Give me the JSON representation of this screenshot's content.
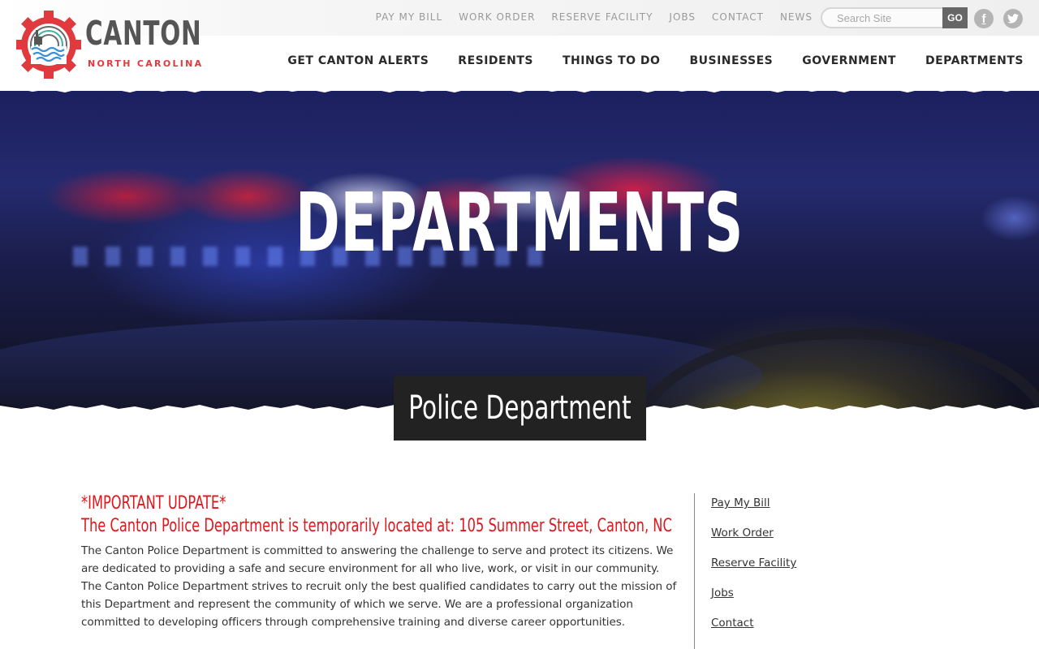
{
  "brand": {
    "name": "CANTON",
    "subtitle": "NORTH CAROLINA",
    "accent_color": "#e03a3e"
  },
  "utility_nav": [
    {
      "label": "PAY MY BILL"
    },
    {
      "label": "WORK ORDER"
    },
    {
      "label": "RESERVE FACILITY"
    },
    {
      "label": "JOBS"
    },
    {
      "label": "CONTACT"
    },
    {
      "label": "NEWS"
    }
  ],
  "search": {
    "placeholder": "Search Site",
    "value": "",
    "button_label": "GO"
  },
  "social": [
    {
      "icon": "facebook-icon",
      "glyph": "f"
    },
    {
      "icon": "twitter-icon",
      "glyph": "🐦"
    }
  ],
  "main_nav": [
    {
      "label": "GET CANTON ALERTS"
    },
    {
      "label": "RESIDENTS"
    },
    {
      "label": "THINGS TO DO"
    },
    {
      "label": "BUSINESSES"
    },
    {
      "label": "GOVERNMENT"
    },
    {
      "label": "DEPARTMENTS"
    }
  ],
  "hero": {
    "title": "DEPARTMENTS"
  },
  "page": {
    "section_title": "Police Department",
    "alert_heading": "*IMPORTANT UDPATE*",
    "alert_message": "The Canton Police Department is temporarily located at: 105 Summer Street, Canton, NC",
    "alert_color": "#e3151a",
    "body": "The Canton Police Department is committed to answering the challenge to serve and protect its citizens. We are dedicated to providing a safe and secure environment for all who live, work, or visit in our community. The Canton Police Department strives to recruit only the best qualified candidates to carry out the mission of this Department and represent the community of which we serve. We are a professional organization committed to developing officers through comprehensive training and diverse career opportunities."
  },
  "sidebar_links": [
    {
      "label": "Pay My Bill"
    },
    {
      "label": "Work Order"
    },
    {
      "label": "Reserve Facility"
    },
    {
      "label": "Jobs"
    },
    {
      "label": "Contact"
    }
  ]
}
